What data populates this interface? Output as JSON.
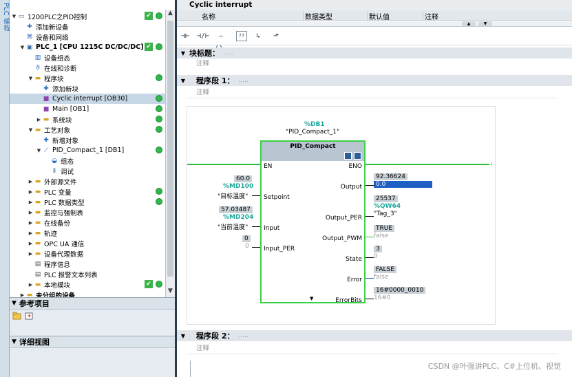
{
  "side_strip": {
    "label": "PLC 编程"
  },
  "tree": {
    "items": [
      {
        "label": "1200PLC之PID控制",
        "icon": "project-icon",
        "indent": 0,
        "expanded": true,
        "bold": false
      },
      {
        "label": "添加新设备",
        "icon": "add-device-icon",
        "indent": 1,
        "bold": false
      },
      {
        "label": "设备和网络",
        "icon": "network-icon",
        "indent": 1,
        "bold": false
      },
      {
        "label": "PLC_1 [CPU 1215C DC/DC/DC]",
        "icon": "cpu-icon",
        "indent": 1,
        "expanded": true,
        "bold": true
      },
      {
        "label": "设备组态",
        "icon": "device-config-icon",
        "indent": 2,
        "bold": false
      },
      {
        "label": "在线和诊断",
        "icon": "diagnostics-icon",
        "indent": 2,
        "bold": false
      },
      {
        "label": "程序块",
        "icon": "folder-icon",
        "indent": 2,
        "expanded": true,
        "bold": false
      },
      {
        "label": "添加新块",
        "icon": "add-block-icon",
        "indent": 3,
        "bold": false
      },
      {
        "label": "Cyclic interrupt [OB30]",
        "icon": "ob-icon",
        "indent": 3,
        "bold": false,
        "selected": true
      },
      {
        "label": "Main [OB1]",
        "icon": "ob-icon",
        "indent": 3,
        "bold": false
      },
      {
        "label": "系统块",
        "icon": "folder-icon",
        "indent": 3,
        "collapsed": true,
        "bold": false
      },
      {
        "label": "工艺对象",
        "icon": "folder-icon",
        "indent": 2,
        "expanded": true,
        "bold": false
      },
      {
        "label": "新增对象",
        "icon": "add-object-icon",
        "indent": 3,
        "bold": false
      },
      {
        "label": "PID_Compact_1 [DB1]",
        "icon": "pid-icon",
        "indent": 3,
        "expanded": true,
        "bold": false
      },
      {
        "label": "组态",
        "icon": "config-icon",
        "indent": 4,
        "bold": false
      },
      {
        "label": "调试",
        "icon": "commissioning-icon",
        "indent": 4,
        "bold": false
      },
      {
        "label": "外部源文件",
        "icon": "folder-icon",
        "indent": 2,
        "collapsed": true,
        "bold": false
      },
      {
        "label": "PLC 变量",
        "icon": "folder-icon",
        "indent": 2,
        "collapsed": true,
        "bold": false
      },
      {
        "label": "PLC 数据类型",
        "icon": "folder-icon",
        "indent": 2,
        "collapsed": true,
        "bold": false
      },
      {
        "label": "监控与强制表",
        "icon": "folder-icon",
        "indent": 2,
        "collapsed": true,
        "bold": false
      },
      {
        "label": "在线备份",
        "icon": "folder-icon",
        "indent": 2,
        "collapsed": true,
        "bold": false
      },
      {
        "label": "轨迹",
        "icon": "folder-icon",
        "indent": 2,
        "collapsed": true,
        "bold": false
      },
      {
        "label": "OPC UA 通信",
        "icon": "folder-icon",
        "indent": 2,
        "collapsed": true,
        "bold": false
      },
      {
        "label": "设备代理数据",
        "icon": "folder-icon",
        "indent": 2,
        "collapsed": true,
        "bold": false
      },
      {
        "label": "程序信息",
        "icon": "program-info-icon",
        "indent": 2,
        "bold": false
      },
      {
        "label": "PLC 报警文本列表",
        "icon": "alarm-text-icon",
        "indent": 2,
        "bold": false
      },
      {
        "label": "本地模块",
        "icon": "folder-icon",
        "indent": 2,
        "collapsed": true,
        "bold": false
      },
      {
        "label": "未分组的设备",
        "icon": "folder-icon",
        "indent": 1,
        "collapsed": true,
        "bold": true
      }
    ]
  },
  "panels": {
    "reference": "参考项目",
    "detail": "详细视图"
  },
  "interface": {
    "title": "Cyclic interrupt",
    "columns": [
      "名称",
      "数据类型",
      "默认值",
      "注释"
    ]
  },
  "block": {
    "title_label": "块标题：",
    "title_dots": ".....",
    "comment": "注释"
  },
  "network1": {
    "label": "程序段 1：",
    "dots": ".....",
    "comment": "注释"
  },
  "network2": {
    "label": "程序段 2：",
    "dots": ".....",
    "comment": "注释"
  },
  "fb": {
    "db_addr": "%DB1",
    "db_name": "\"PID_Compact_1\"",
    "name": "PID_Compact",
    "pins_left": [
      "EN",
      "Setpoint",
      "Input",
      "Input_PER"
    ],
    "pins_right": [
      "ENO",
      "Output",
      "Output_PER",
      "Output_PWM",
      "State",
      "Error",
      "ErrorBits"
    ]
  },
  "params": {
    "setpoint_value": "60.0",
    "setpoint_addr": "%MD100",
    "setpoint_tag": "\"目标温度\"",
    "input_value": "57.03487",
    "input_addr": "%MD204",
    "input_tag": "\"当前温度\"",
    "input_per_value": "0",
    "input_per_tag": "0",
    "output_value": "92.36624",
    "output_tag": "0.0",
    "output_per_value": "25537",
    "output_per_addr": "%QW64",
    "output_per_tag": "\"Tag_3\"",
    "output_pwm_value": "TRUE",
    "output_pwm_tag": "false",
    "state_value": "3",
    "state_tag": "0",
    "error_value": "FALSE",
    "error_tag": "false",
    "errorbits_value": "16#0000_0010",
    "errorbits_tag": "16#0"
  },
  "watermark": "CSDN @叶强讲PLC、C#上位机、视觉",
  "colors": {
    "accent_blue": "#1f5fc4",
    "green_ok": "#2fb74a",
    "network_green": "#3cd047",
    "address_teal": "#1aa89a"
  }
}
